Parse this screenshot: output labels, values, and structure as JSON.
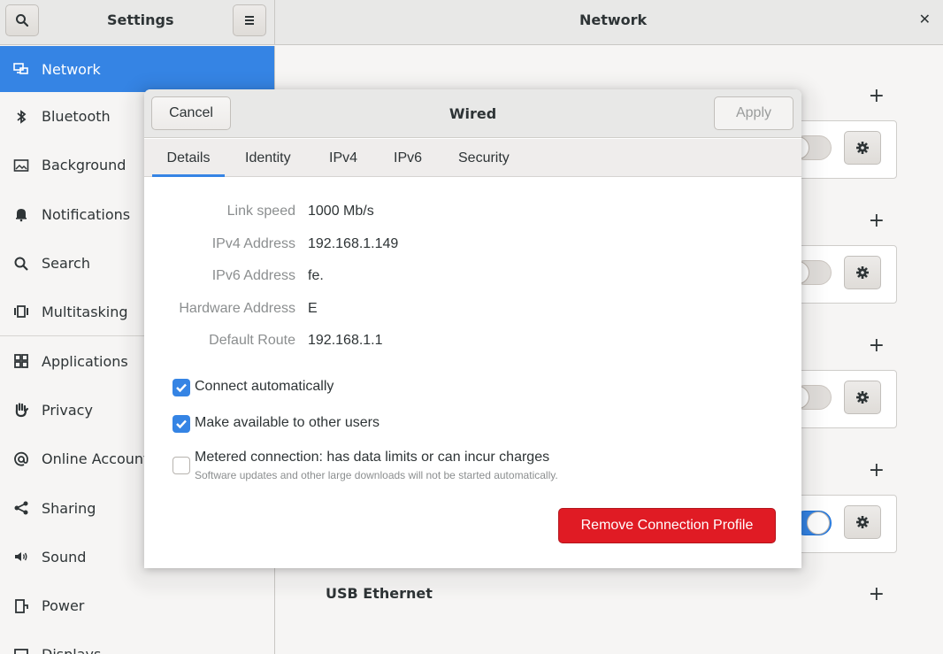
{
  "left_header": {
    "title": "Settings"
  },
  "right_header": {
    "title": "Network"
  },
  "sidebar": {
    "items": [
      {
        "label": "Network"
      },
      {
        "label": "Bluetooth"
      },
      {
        "label": "Background"
      },
      {
        "label": "Notifications"
      },
      {
        "label": "Search"
      },
      {
        "label": "Multitasking"
      },
      {
        "label": "Applications"
      },
      {
        "label": "Privacy"
      },
      {
        "label": "Online Accounts"
      },
      {
        "label": "Sharing"
      },
      {
        "label": "Sound"
      },
      {
        "label": "Power"
      },
      {
        "label": "Displays"
      }
    ]
  },
  "main": {
    "usb_ethernet_label": "USB Ethernet"
  },
  "dialog": {
    "title": "Wired",
    "cancel_label": "Cancel",
    "apply_label": "Apply",
    "tabs": [
      "Details",
      "Identity",
      "IPv4",
      "IPv6",
      "Security"
    ],
    "details": [
      {
        "label": "Link speed",
        "value": "1000 Mb/s"
      },
      {
        "label": "IPv4 Address",
        "value": "192.168.1.149"
      },
      {
        "label": "IPv6 Address",
        "value": "fe."
      },
      {
        "label": "Hardware Address",
        "value": "E"
      },
      {
        "label": "Default Route",
        "value": "192.168.1.1"
      }
    ],
    "connect_auto_label": "Connect automatically",
    "make_available_label": "Make available to other users",
    "metered_label": "Metered connection: has data limits or can incur charges",
    "metered_sub": "Software updates and other large downloads will not be started automatically.",
    "remove_label": "Remove Connection Profile"
  },
  "colors": {
    "accent": "#3584e4",
    "destructive": "#e01b24"
  }
}
